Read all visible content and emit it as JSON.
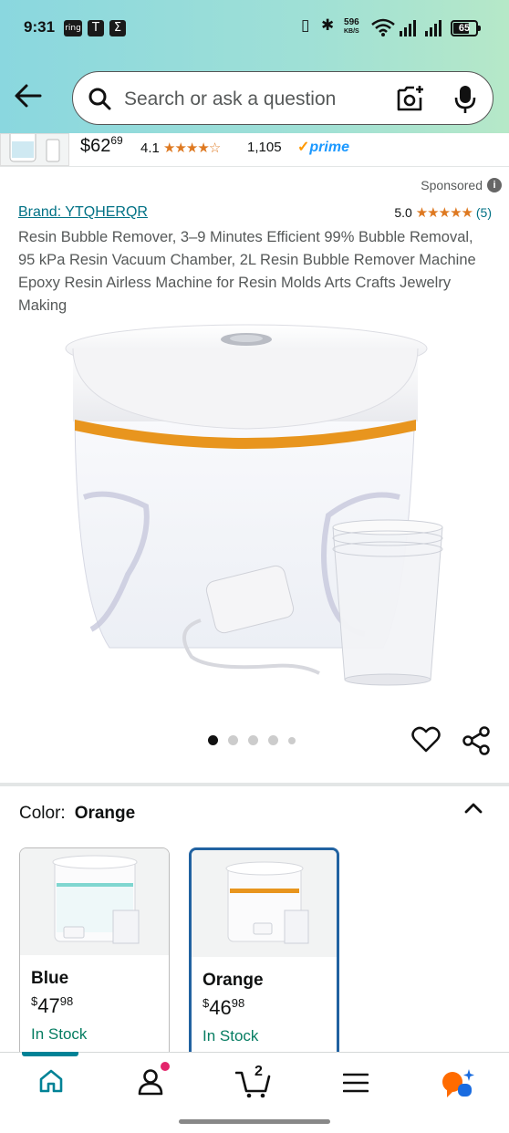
{
  "status_bar": {
    "time": "9:31",
    "icons": [
      "ring-app-icon",
      "tesla-icon",
      "sigma-app-icon"
    ],
    "network_speed": "596",
    "network_unit": "KB/S",
    "battery": "65"
  },
  "header": {
    "search_placeholder": "Search or ask a question"
  },
  "previous_item": {
    "price_whole": "$62",
    "price_fraction": "69",
    "rating": "4.1",
    "stars": "★★★★☆",
    "review_count": "1,105",
    "prime_label": "prime"
  },
  "sponsored_label": "Sponsored",
  "product": {
    "brand": "Brand: YTQHERQR",
    "rating": "5.0",
    "stars": "★★★★★",
    "review_count": "(5)",
    "title": "Resin Bubble Remover, 3–9 Minutes Efficient 99% Bubble Removal, 95 kPa Resin Vacuum Chamber, 2L Resin Bubble Remover Machine Epoxy Resin Airless Machine for Resin Molds Arts Crafts Jewelry Making",
    "image_count": 5,
    "active_image": 1
  },
  "color_selector": {
    "label": "Color:",
    "selected": "Orange",
    "options": [
      {
        "name": "Blue",
        "currency": "$",
        "whole": "47",
        "fraction": "98",
        "stock": "In Stock",
        "accent": "#7fd6d0"
      },
      {
        "name": "Orange",
        "currency": "$",
        "whole": "46",
        "fraction": "98",
        "stock": "In Stock",
        "accent": "#e8951e"
      }
    ]
  },
  "bottom_nav": {
    "items": [
      "home-icon",
      "account-icon",
      "cart-icon",
      "menu-icon",
      "rufus-ai-icon"
    ],
    "cart_count": "2",
    "active": "home-icon"
  },
  "colors": {
    "link": "#007185",
    "stock_green": "#067d62",
    "star_orange": "#de7921",
    "selected_border": "#2162a1",
    "prime_blue": "#1a98ff"
  }
}
